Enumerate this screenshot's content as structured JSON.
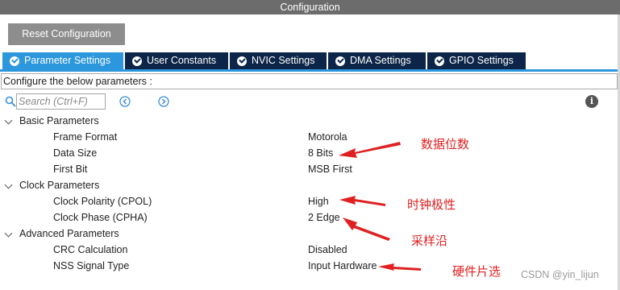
{
  "window": {
    "title": "Configuration"
  },
  "toolbar": {
    "reset_label": "Reset Configuration"
  },
  "tabs": [
    {
      "label": "Parameter Settings",
      "active": true
    },
    {
      "label": "User Constants",
      "active": false
    },
    {
      "label": "NVIC Settings",
      "active": false
    },
    {
      "label": "DMA Settings",
      "active": false
    },
    {
      "label": "GPIO Settings",
      "active": false
    }
  ],
  "configure_text": "Configure the below parameters :",
  "search": {
    "placeholder": "Search (Ctrl+F)"
  },
  "groups": [
    {
      "label": "Basic Parameters",
      "params": [
        {
          "name": "Frame Format",
          "value": "Motorola"
        },
        {
          "name": "Data Size",
          "value": "8 Bits"
        },
        {
          "name": "First Bit",
          "value": "MSB First"
        }
      ]
    },
    {
      "label": "Clock Parameters",
      "params": [
        {
          "name": "Clock Polarity (CPOL)",
          "value": "High"
        },
        {
          "name": "Clock Phase (CPHA)",
          "value": "2 Edge"
        }
      ]
    },
    {
      "label": "Advanced Parameters",
      "params": [
        {
          "name": "CRC Calculation",
          "value": "Disabled"
        },
        {
          "name": "NSS Signal Type",
          "value": "Input Hardware"
        }
      ]
    }
  ],
  "annotations": {
    "data_size": "数据位数",
    "cpol": "时钟极性",
    "cpha": "采样沿",
    "nss": "硬件片选"
  },
  "watermark": "CSDN @yin_lijun",
  "colors": {
    "titlebar": "#6c6c6c",
    "tab_active": "#2c97dd",
    "tab_inactive": "#0c2548",
    "annotation": "#e02020"
  },
  "icons": {
    "tab_check": "check-circle-icon",
    "search": "search-icon",
    "prev": "chevron-left-icon",
    "next": "chevron-right-icon",
    "info": "info-icon",
    "group_toggle": "chevron-down-icon"
  }
}
